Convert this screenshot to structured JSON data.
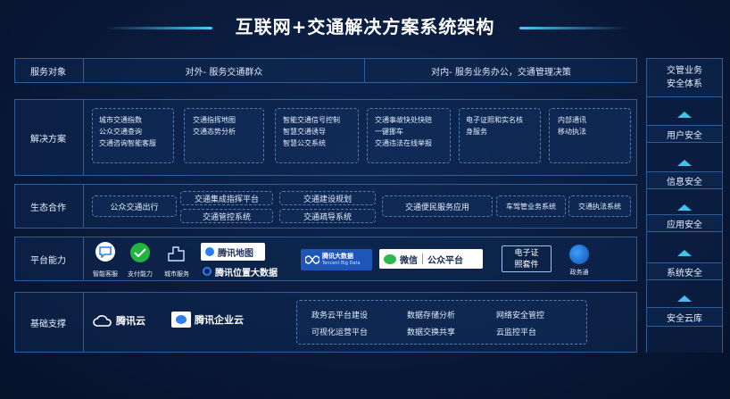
{
  "title": "互联网+交通解决方案系统架构",
  "rows": {
    "service": {
      "label": "服务对象",
      "external": "对外- 服务交通群众",
      "internal": "对内- 服务业务办公，交通管理决策"
    },
    "solution": {
      "label": "解决方案",
      "boxes": [
        [
          "城市交通指数",
          "公众交通查询",
          "交通咨询智能客服"
        ],
        [
          "交通指挥地图",
          "交通态势分析"
        ],
        [
          "智能交通信号控制",
          "智慧交通诱导",
          "智慧公交系统"
        ],
        [
          "交通事故快处快赔",
          "一键挪车",
          "交通违法在线举报"
        ],
        [
          "电子证照和实名核",
          "身服务"
        ],
        [
          "内部通讯",
          "移动执法"
        ]
      ]
    },
    "ecosystem": {
      "label": "生态合作",
      "items": {
        "public_transit": "公众交通出行",
        "integrated_command": "交通集成指挥平台",
        "control_system": "交通管控系统",
        "construction_planning": "交通建设规划",
        "guidance_system": "交通疏导系统",
        "convenience_app": "交通便民服务应用",
        "vehicle_mgmt": "车驾管业务系统",
        "law_enforcement": "交通执法系统"
      }
    },
    "platform": {
      "label": "平台能力",
      "smart_service": "智能客服",
      "payment": "支付能力",
      "city_service": "城市服务",
      "tencent_map": "腾讯地图",
      "tencent_location": "腾讯位置大数据",
      "tencent_bigdata": "腾讯大数据",
      "tencent_bigdata_en": "Tencent Big Data",
      "wechat": "微信",
      "official_account": "公众平台",
      "ecert_line1": "电子证",
      "ecert_line2": "照套件",
      "gov_pass": "政务通"
    },
    "foundation": {
      "label": "基础支撑",
      "tencent_cloud": "腾讯云",
      "tencent_enterprise_cloud": "腾讯企业云",
      "services": [
        [
          "政务云平台建设",
          "数据存储分析",
          "网络安全管控"
        ],
        [
          "可视化运营平台",
          "数据交换共享",
          "云监控平台"
        ]
      ]
    }
  },
  "security": {
    "header_line1": "交管业务",
    "header_line2": "安全体系",
    "items": [
      "用户安全",
      "信息安全",
      "应用安全",
      "系统安全",
      "安全云库"
    ]
  },
  "colors": {
    "background": "#0a1a3a",
    "border": "#2e5d98",
    "accent": "#3ec3f0",
    "text": "#e6efff"
  }
}
